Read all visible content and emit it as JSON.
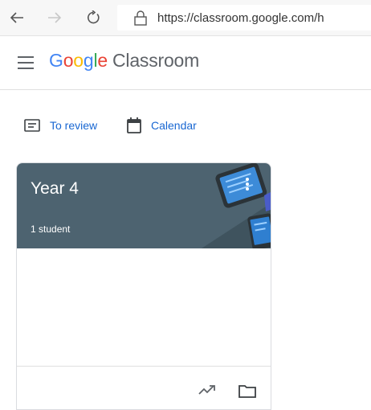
{
  "browser": {
    "url": "https://classroom.google.com/h",
    "icons": [
      "back-arrow-icon",
      "forward-arrow-icon",
      "refresh-icon",
      "lock-icon"
    ]
  },
  "header": {
    "brand_letters": [
      "G",
      "o",
      "o",
      "g",
      "l",
      "e"
    ],
    "product": "Classroom"
  },
  "toolbar": {
    "review_label": "To review",
    "calendar_label": "Calendar"
  },
  "class_card": {
    "title": "Year 4",
    "subtitle": "1 student",
    "banner_color": "#4d6370"
  },
  "colors": {
    "accent": "#1967d2",
    "google_blue": "#4285f4",
    "google_red": "#ea4335",
    "google_yellow": "#fbbc05",
    "google_green": "#34a853"
  }
}
